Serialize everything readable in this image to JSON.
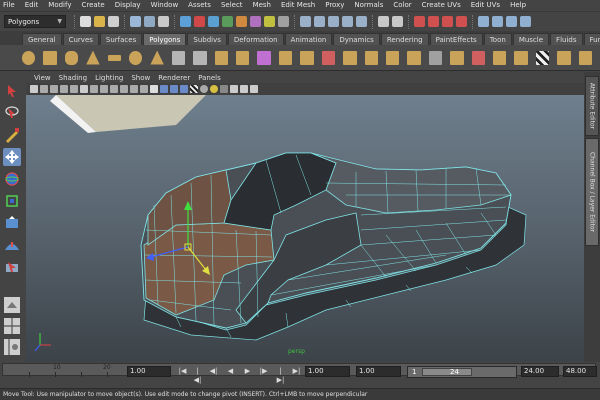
{
  "menubar": [
    "File",
    "Edit",
    "Modify",
    "Create",
    "Display",
    "Window",
    "Assets",
    "Select",
    "Mesh",
    "Edit Mesh",
    "Proxy",
    "Normals",
    "Color",
    "Create UVs",
    "Edit UVs",
    "Help"
  ],
  "statusline": {
    "mode": "Polygons"
  },
  "shelf_tabs": [
    "General",
    "Curves",
    "Surfaces",
    "Polygons",
    "Subdivs",
    "Deformation",
    "Animation",
    "Dynamics",
    "Rendering",
    "PaintEffects",
    "Toon",
    "Muscle",
    "Fluids",
    "Fur"
  ],
  "active_shelf_tab": "Polygons",
  "panel_menu": [
    "View",
    "Shading",
    "Lighting",
    "Show",
    "Renderer",
    "Panels"
  ],
  "viewport": {
    "camera_label": "persp"
  },
  "sidebar_tabs": [
    "Attribute Editor",
    "Channel Box / Layer Editor"
  ],
  "time_slider": {
    "ticks": [
      "10",
      "20"
    ]
  },
  "range_slider": {
    "current_time": "1.00",
    "start_time": "1.00",
    "range_start_field": "1.00",
    "range_start": "1",
    "range_end": "24",
    "end_time": "24.00",
    "playback_end": "48.00"
  },
  "playback_buttons": [
    "|◀",
    "|◀|",
    "◀|",
    "◀",
    "▶",
    "|▶",
    "|▶|",
    "▶|"
  ],
  "help_line": "Move Tool: Use manipulator to move object(s). Use edit mode to change pivot (INSERT).  Ctrl+LMB to move perpendicular",
  "colors": {
    "wireframe": "#7fe3e6",
    "mesh_dark": "#4a4f55",
    "mesh_selected_faces": "#7a5a47",
    "viewport_top": "#6f7f8d",
    "viewport_bottom": "#3c4349"
  }
}
